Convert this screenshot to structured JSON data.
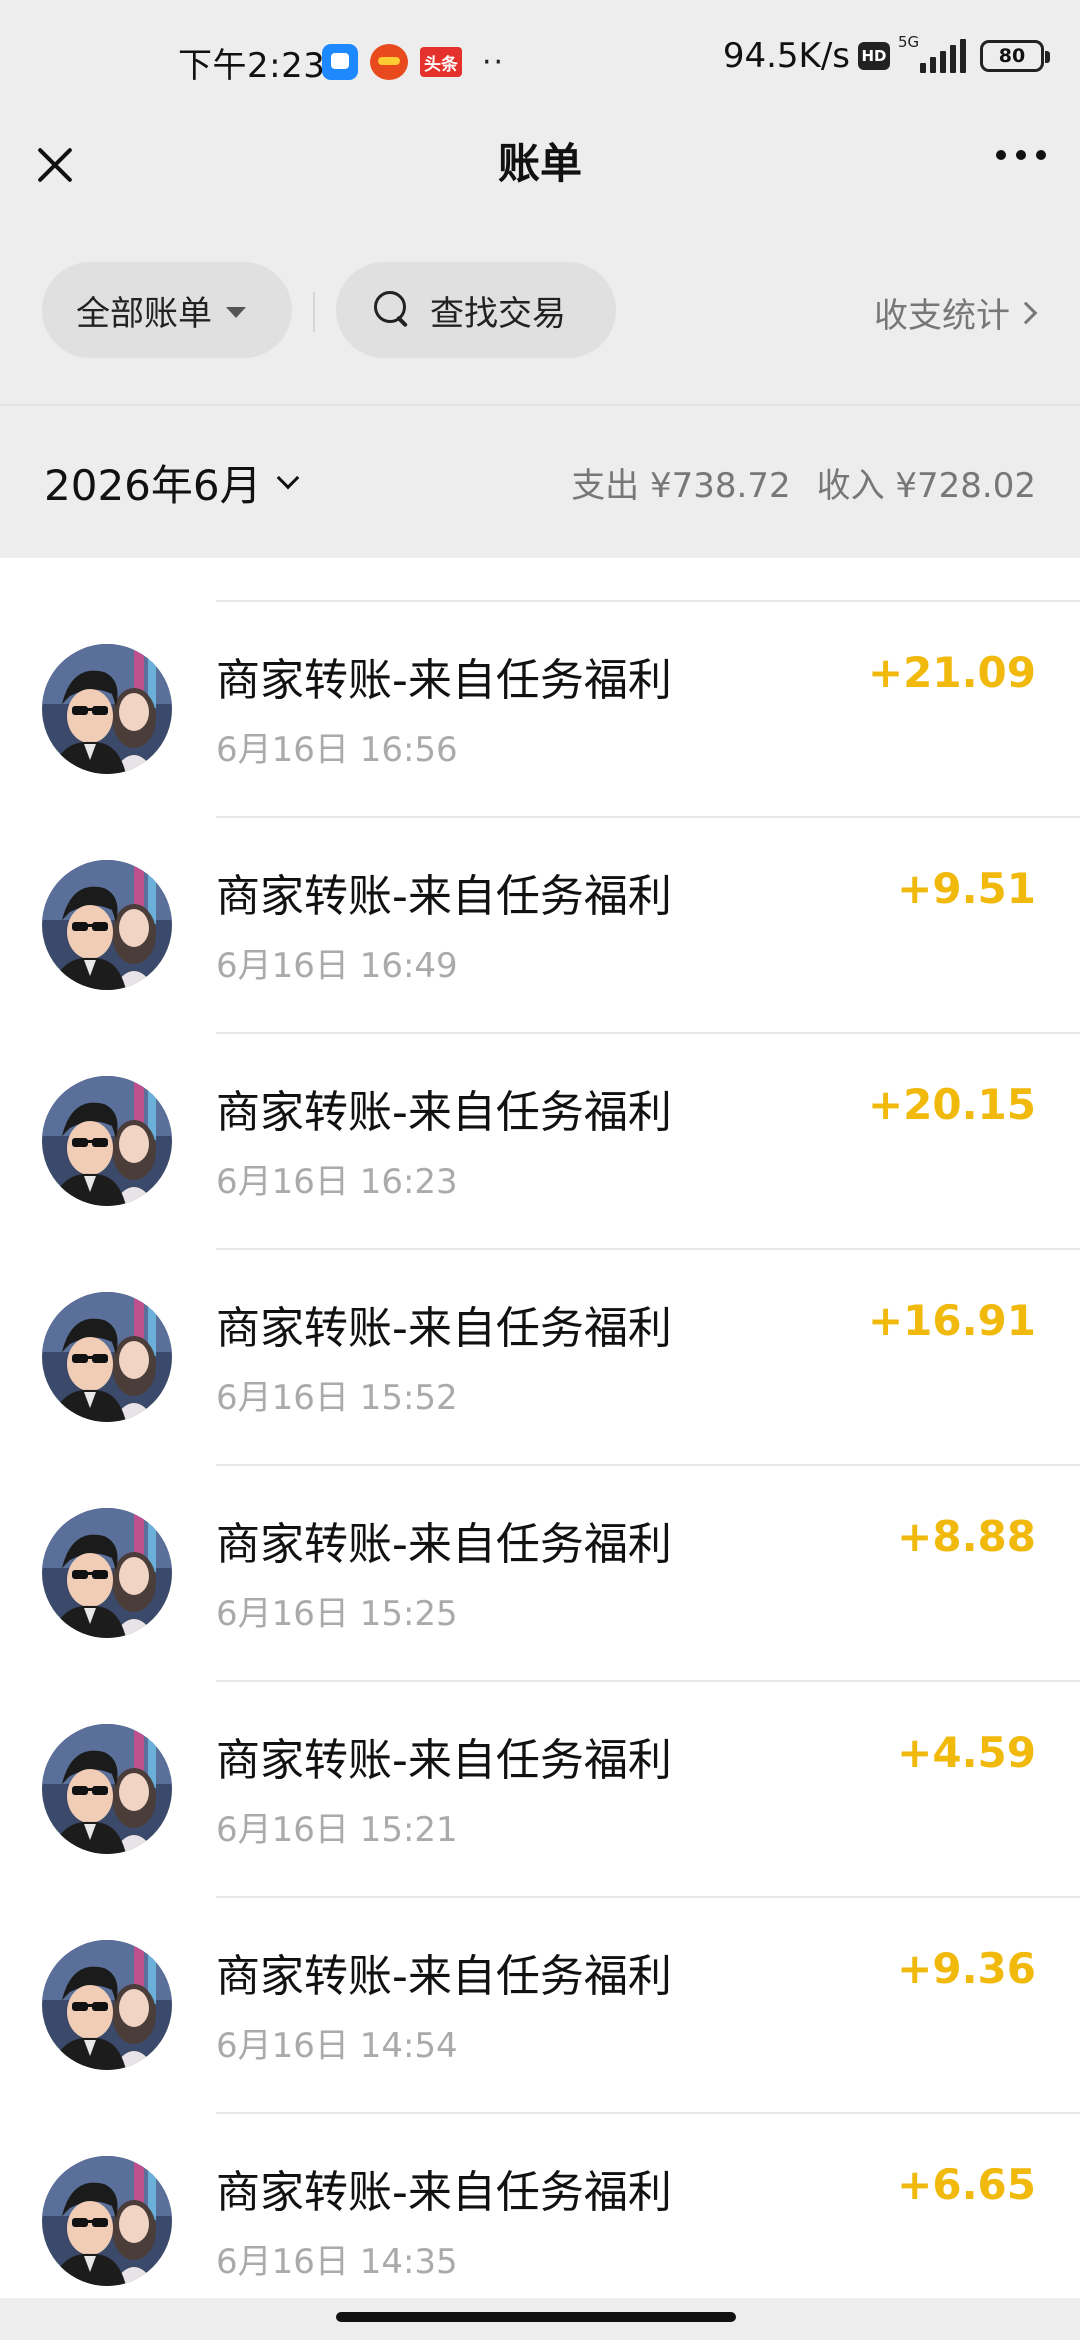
{
  "status_bar": {
    "time": "下午2:23",
    "toutiao_label": "头条",
    "more": "··",
    "net_speed": "94.5K/s",
    "hd": "HD",
    "network": "5G",
    "battery": "80"
  },
  "nav": {
    "title": "账单"
  },
  "filters": {
    "all_bills": "全部账单",
    "search": "查找交易",
    "stats": "收支统计"
  },
  "month": {
    "label": "2026年6月",
    "expense": "支出 ¥738.72",
    "income": "收入 ¥728.02"
  },
  "colors": {
    "amount": "#f0b90b",
    "background": "#ededed"
  },
  "transactions": [
    {
      "title": "商家转账-来自任务福利",
      "time": "6月16日 16:56",
      "amount": "+21.09"
    },
    {
      "title": "商家转账-来自任务福利",
      "time": "6月16日 16:49",
      "amount": "+9.51"
    },
    {
      "title": "商家转账-来自任务福利",
      "time": "6月16日 16:23",
      "amount": "+20.15"
    },
    {
      "title": "商家转账-来自任务福利",
      "time": "6月16日 15:52",
      "amount": "+16.91"
    },
    {
      "title": "商家转账-来自任务福利",
      "time": "6月16日 15:25",
      "amount": "+8.88"
    },
    {
      "title": "商家转账-来自任务福利",
      "time": "6月16日 15:21",
      "amount": "+4.59"
    },
    {
      "title": "商家转账-来自任务福利",
      "time": "6月16日 14:54",
      "amount": "+9.36"
    },
    {
      "title": "商家转账-来自任务福利",
      "time": "6月16日 14:35",
      "amount": "+6.65"
    }
  ]
}
